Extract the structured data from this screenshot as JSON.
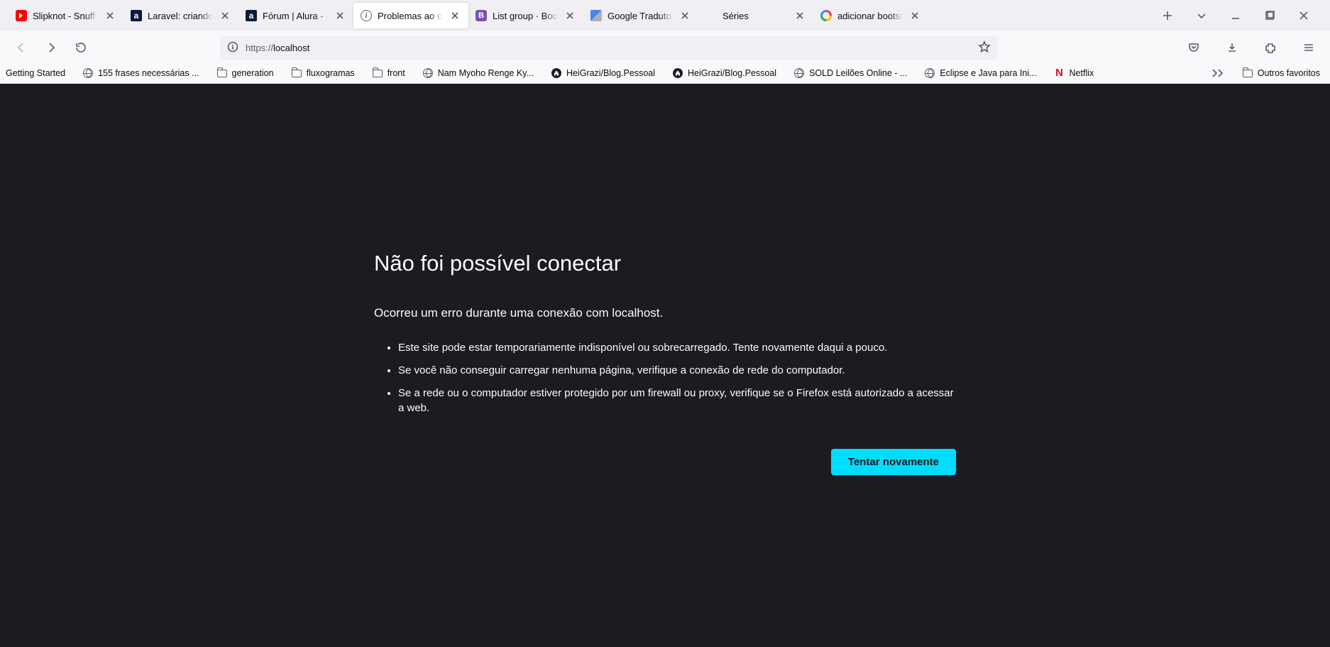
{
  "tabs": [
    {
      "title": "Slipknot - Snuff [O",
      "favicon": "youtube"
    },
    {
      "title": "Laravel: criando u",
      "favicon": "alura"
    },
    {
      "title": "Fórum | Alura - Cu",
      "favicon": "alura"
    },
    {
      "title": "Problemas ao car",
      "favicon": "info",
      "active": true
    },
    {
      "title": "List group · Bootst",
      "favicon": "bootstrap"
    },
    {
      "title": "Google Tradutor",
      "favicon": "gt"
    },
    {
      "title": "Séries",
      "favicon": "blank"
    },
    {
      "title": "adicionar bootstra",
      "favicon": "google"
    }
  ],
  "url": {
    "scheme": "https://",
    "host": "localhost"
  },
  "bookmarks": [
    {
      "label": "Getting Started",
      "icon": "none"
    },
    {
      "label": "155 frases necessárias ...",
      "icon": "globe"
    },
    {
      "label": "generation",
      "icon": "folder"
    },
    {
      "label": "fluxogramas",
      "icon": "folder"
    },
    {
      "label": "front",
      "icon": "folder"
    },
    {
      "label": "Nam Myoho Renge Ky...",
      "icon": "globe"
    },
    {
      "label": "HeiGrazi/Blog.Pessoal",
      "icon": "github"
    },
    {
      "label": "HeiGrazi/Blog.Pessoal",
      "icon": "github"
    },
    {
      "label": "SOLD Leilões Online - ...",
      "icon": "globe"
    },
    {
      "label": "Eclipse e Java para Ini...",
      "icon": "globe"
    },
    {
      "label": "Netflix",
      "icon": "netflix"
    }
  ],
  "other_bookmarks_label": "Outros favoritos",
  "error": {
    "title": "Não foi possível conectar",
    "sub": "Ocorreu um erro durante uma conexão com localhost.",
    "bullets": [
      "Este site pode estar temporariamente indisponível ou sobrecarregado. Tente novamente daqui a pouco.",
      "Se você não conseguir carregar nenhuma página, verifique a conexão de rede do computador.",
      "Se a rede ou o computador estiver protegido por um firewall ou proxy, verifique se o Firefox está autorizado a acessar a web."
    ],
    "retry": "Tentar novamente"
  }
}
